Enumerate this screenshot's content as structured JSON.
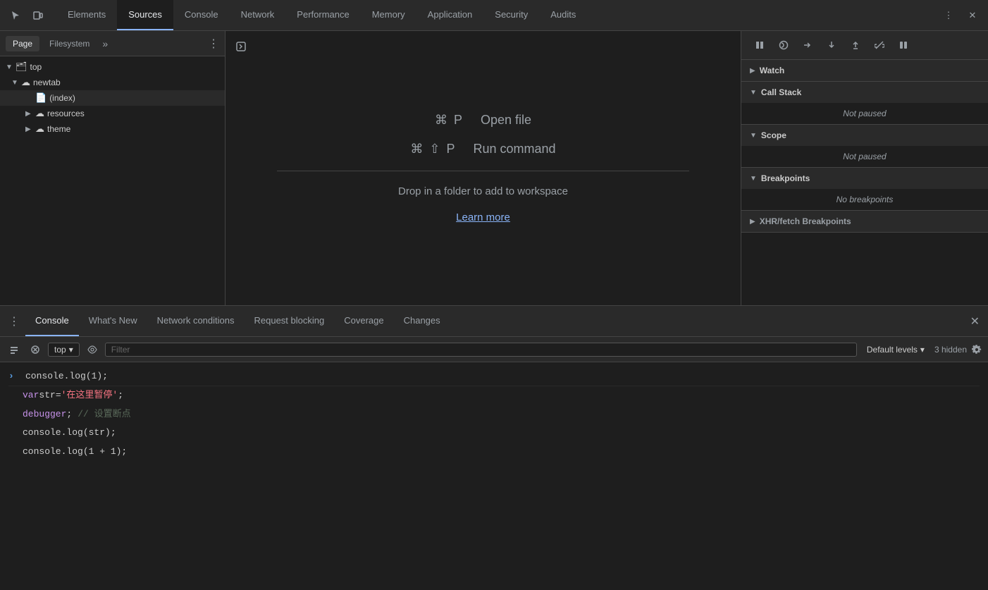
{
  "topBar": {
    "tabs": [
      {
        "id": "elements",
        "label": "Elements",
        "active": false
      },
      {
        "id": "sources",
        "label": "Sources",
        "active": true
      },
      {
        "id": "console",
        "label": "Console",
        "active": false
      },
      {
        "id": "network",
        "label": "Network",
        "active": false
      },
      {
        "id": "performance",
        "label": "Performance",
        "active": false
      },
      {
        "id": "memory",
        "label": "Memory",
        "active": false
      },
      {
        "id": "application",
        "label": "Application",
        "active": false
      },
      {
        "id": "security",
        "label": "Security",
        "active": false
      },
      {
        "id": "audits",
        "label": "Audits",
        "active": false
      }
    ]
  },
  "leftPanel": {
    "tabs": [
      {
        "id": "page",
        "label": "Page",
        "active": true
      },
      {
        "id": "filesystem",
        "label": "Filesystem",
        "active": false
      }
    ],
    "fileTree": [
      {
        "indent": 0,
        "arrow": "▼",
        "icon": "📄",
        "iconType": "folder",
        "label": "top"
      },
      {
        "indent": 1,
        "arrow": "▼",
        "icon": "☁",
        "iconType": "cloud",
        "label": "newtab"
      },
      {
        "indent": 2,
        "arrow": "",
        "icon": "📄",
        "iconType": "file",
        "label": "(index)",
        "selected": true
      },
      {
        "indent": 2,
        "arrow": "▶",
        "icon": "☁",
        "iconType": "cloud",
        "label": "resources"
      },
      {
        "indent": 2,
        "arrow": "▶",
        "icon": "☁",
        "iconType": "cloud",
        "label": "theme"
      }
    ]
  },
  "centerPanel": {
    "shortcut1": {
      "keys": "⌘ P",
      "label": "Open file"
    },
    "shortcut2": {
      "keys": "⌘ ⇧ P",
      "label": "Run command"
    },
    "dropText": "Drop in a folder to add to workspace",
    "learnMore": "Learn more"
  },
  "rightPanel": {
    "sections": [
      {
        "id": "watch",
        "arrow": "▶",
        "label": "Watch",
        "expanded": false
      },
      {
        "id": "callstack",
        "arrow": "▼",
        "label": "Call Stack",
        "expanded": true,
        "content": "Not paused"
      },
      {
        "id": "scope",
        "arrow": "▼",
        "label": "Scope",
        "expanded": true,
        "content": "Not paused"
      },
      {
        "id": "breakpoints",
        "arrow": "▼",
        "label": "Breakpoints",
        "expanded": true,
        "content": "No breakpoints"
      },
      {
        "id": "xhrfetch",
        "arrow": "▶",
        "label": "XHR/fetch Breakpoints",
        "expanded": false
      }
    ]
  },
  "bottomTabs": {
    "tabs": [
      {
        "id": "console",
        "label": "Console",
        "active": true
      },
      {
        "id": "whatsnew",
        "label": "What's New",
        "active": false
      },
      {
        "id": "networkconditions",
        "label": "Network conditions",
        "active": false
      },
      {
        "id": "requestblocking",
        "label": "Request blocking",
        "active": false
      },
      {
        "id": "coverage",
        "label": "Coverage",
        "active": false
      },
      {
        "id": "changes",
        "label": "Changes",
        "active": false
      }
    ]
  },
  "consoleToolbar": {
    "contextLabel": "top",
    "filterPlaceholder": "Filter",
    "levelsLabel": "Default levels",
    "hiddenCount": "3 hidden"
  },
  "consoleOutput": {
    "line1": "console.log(1);",
    "line2_keyword": "var",
    "line2_varname": " str",
    "line2_op": " = ",
    "line2_string": "'在这里暂停'",
    "line2_semi": ";",
    "line3_keyword": "debugger",
    "line3_comment": "// 设置断点",
    "line3_semi": ";",
    "line4": "console.log(str);",
    "line5": "console.log(1 + 1);"
  }
}
